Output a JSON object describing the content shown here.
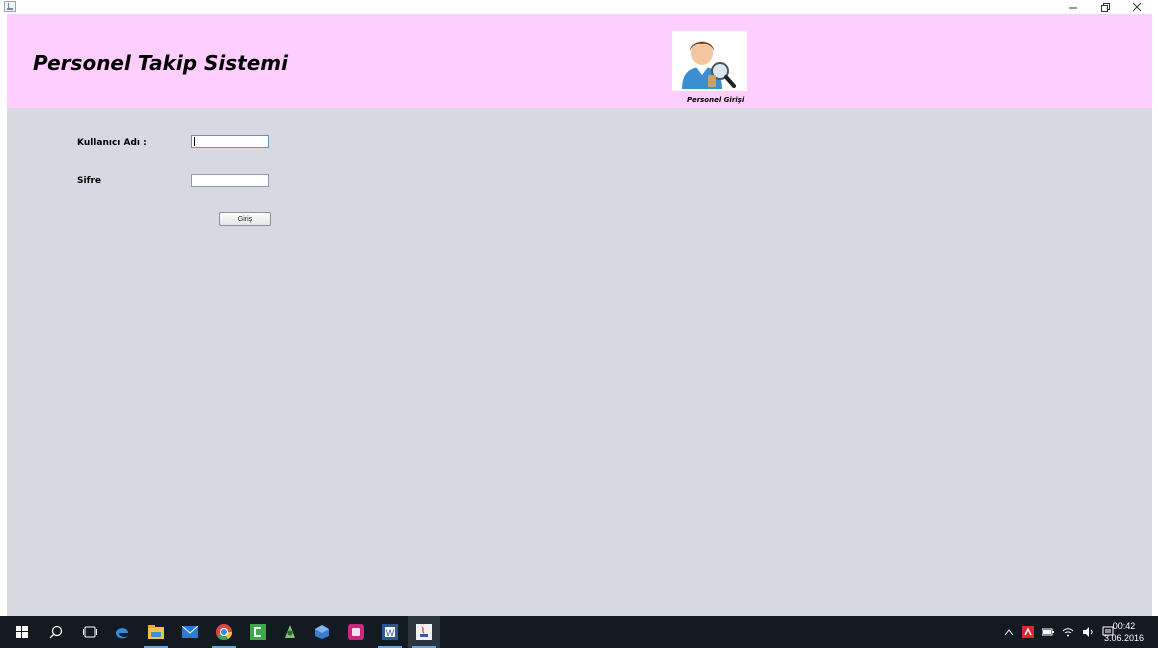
{
  "window": {
    "controls": {
      "minimize": "−",
      "maximize": "❐",
      "close": "✕"
    }
  },
  "header": {
    "title": "Personel Takip Sistemi",
    "avatar_caption": "Personel Girişi",
    "background": "#fdcefe"
  },
  "form": {
    "username_label": "Kullanıcı Adı :",
    "username_value": "",
    "password_label": "Sifre",
    "password_value": "",
    "login_button": "Giriş"
  },
  "taskbar": {
    "icons": [
      "windows-start-icon",
      "search-icon",
      "task-view-icon",
      "edge-icon",
      "file-explorer-icon",
      "mail-icon",
      "chrome-icon",
      "camtasia-icon",
      "android-studio-icon",
      "virtualbox-icon",
      "app-icon",
      "word-icon",
      "java-icon"
    ],
    "clock_time": "00:42",
    "clock_date": "3.06.2016"
  },
  "colors": {
    "app_background": "#d6d9e1",
    "taskbar": "#141a22"
  }
}
